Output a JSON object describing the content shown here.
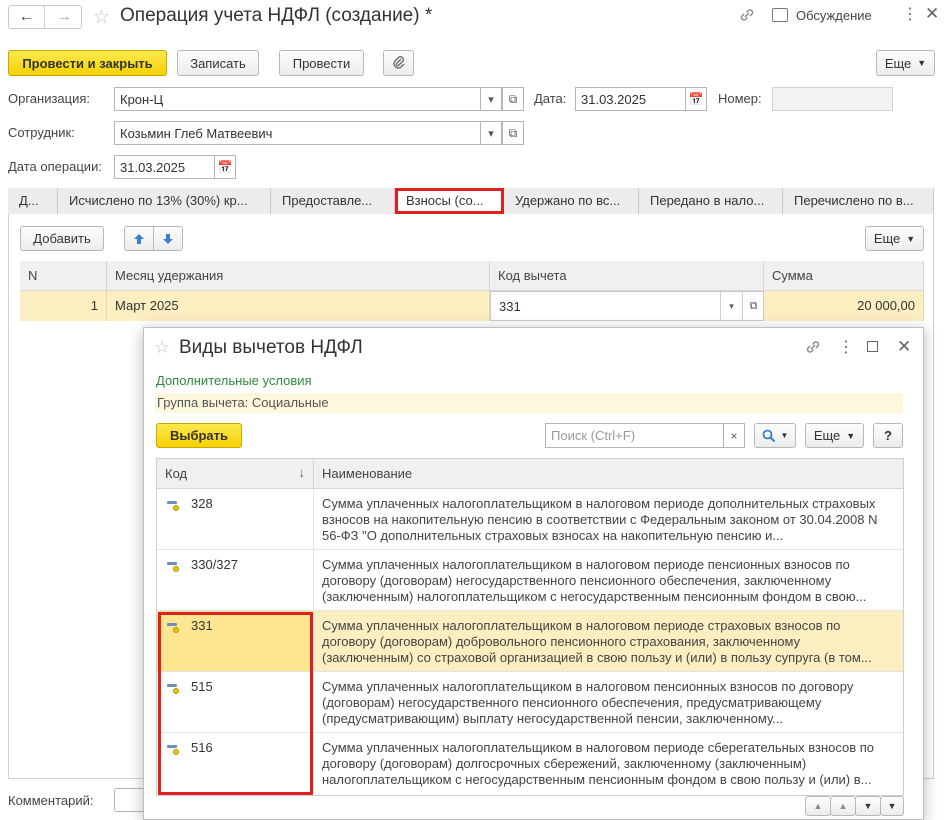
{
  "window": {
    "title": "Операция учета НДФЛ (создание) *",
    "discussion": "Обсуждение"
  },
  "toolbar": {
    "post_close": "Провести и закрыть",
    "save": "Записать",
    "post": "Провести",
    "more": "Еще"
  },
  "form": {
    "org_label": "Организация:",
    "org_value": "Крон-Ц",
    "date_label": "Дата:",
    "date_value": "31.03.2025",
    "number_label": "Номер:",
    "employee_label": "Сотрудник:",
    "employee_value": "Козьмин Глеб Матвеевич",
    "opdate_label": "Дата операции:",
    "opdate_value": "31.03.2025",
    "comment_label": "Комментарий:"
  },
  "tabs": [
    "Д...",
    "Исчислено по 13% (30%) кр...",
    "Предоставле...",
    "Взносы (со...",
    "Удержано по вс...",
    "Передано в нало...",
    "Перечислено по в..."
  ],
  "table_toolbar": {
    "add": "Добавить",
    "more": "Еще"
  },
  "table": {
    "headers": {
      "n": "N",
      "month": "Месяц удержания",
      "code": "Код вычета",
      "sum": "Сумма"
    },
    "rows": [
      {
        "n": "1",
        "month": "Март 2025",
        "code": "331",
        "sum": "20 000,00"
      }
    ]
  },
  "dialog": {
    "title": "Виды вычетов НДФЛ",
    "extra": "Дополнительные условия",
    "group": "Группа вычета: Социальные",
    "select": "Выбрать",
    "search_placeholder": "Поиск (Ctrl+F)",
    "more": "Еще",
    "help": "?",
    "headers": {
      "code": "Код",
      "name": "Наименование"
    },
    "rows": [
      {
        "code": "328",
        "name": "Сумма уплаченных налогоплательщиком в налоговом периоде дополнительных страховых взносов на накопительную пенсию в соответствии с Федеральным законом от 30.04.2008 N 56-ФЗ \"О дополнительных страховых взносах на накопительную пенсию и..."
      },
      {
        "code": "330/327",
        "name": "Сумма уплаченных налогоплательщиком в налоговом периоде пенсионных взносов по договору (договорам) негосударственного пенсионного обеспечения, заключенному (заключенным) налогоплательщиком с негосударственным пенсионным фондом в свою..."
      },
      {
        "code": "331",
        "name": "Сумма уплаченных налогоплательщиком в налоговом периоде страховых взносов по договору (договорам) добровольного пенсионного страхования, заключенному (заключенным) со страховой организацией в свою пользу и (или) в пользу супруга (в том..."
      },
      {
        "code": "515",
        "name": "Сумма уплаченных налогоплательщиком в налоговом пенсионных взносов по договору (договорам) негосударственного пенсионного обеспечения, предусматривающему (предусматривающим) выплату негосударственной пенсии, заключенному..."
      },
      {
        "code": "516",
        "name": "Сумма уплаченных налогоплательщиком в налоговом периоде сберегательных взносов по договору (договорам) долгосрочных сбережений, заключенному (заключенным) налогоплательщиком с негосударственным пенсионным фондом в свою пользу и (или) в..."
      }
    ]
  }
}
